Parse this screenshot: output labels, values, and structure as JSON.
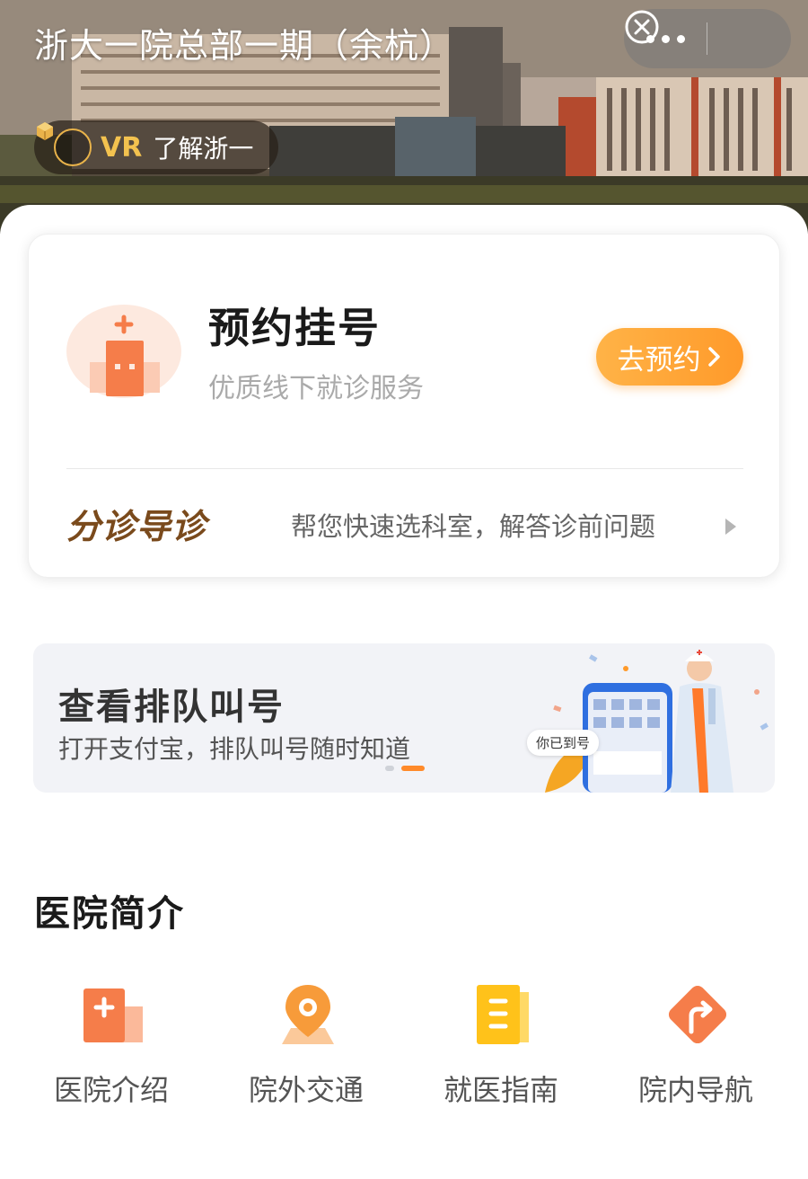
{
  "header": {
    "title": "浙大一院总部一期（余杭）",
    "vr_badge": "VR",
    "vr_label": "了解浙一"
  },
  "appointment": {
    "title": "预约挂号",
    "subtitle": "优质线下就诊服务",
    "button_label": "去预约",
    "button_color": "#ff9a2a"
  },
  "triage": {
    "logo_text": "分诊导诊",
    "description": "帮您快速选科室，解答诊前问题"
  },
  "queue_banner": {
    "title": "查看排队叫号",
    "subtitle": "打开支付宝，排队叫号随时知道",
    "phone_label": "你已到号",
    "carousel_count": 2,
    "carousel_active_index": 1
  },
  "intro": {
    "section_title": "医院简介",
    "items": [
      {
        "label": "医院介绍",
        "icon": "hospital-card-icon"
      },
      {
        "label": "院外交通",
        "icon": "location-pin-icon"
      },
      {
        "label": "就医指南",
        "icon": "guide-book-icon"
      },
      {
        "label": "院内导航",
        "icon": "navigation-arrow-icon"
      }
    ]
  },
  "colors": {
    "accent_orange": "#ff8a2a",
    "triage_brown": "#7a4a1c",
    "vr_gold": "#f3c24f"
  }
}
